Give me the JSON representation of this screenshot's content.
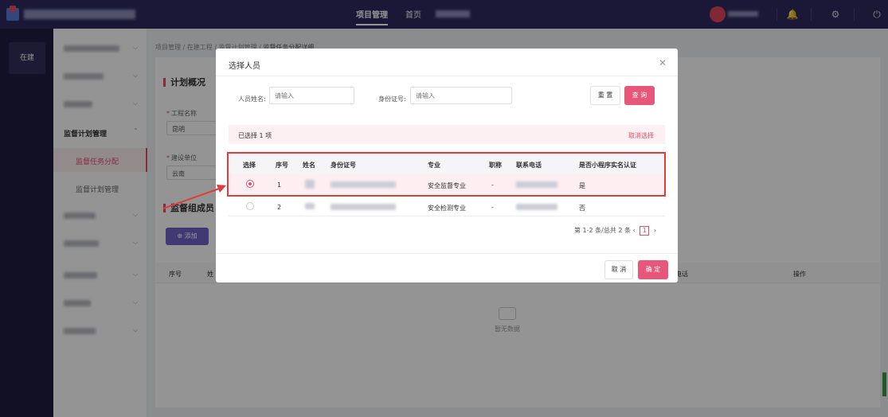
{
  "topbar": {
    "nav_active": "项目管理",
    "nav_home": "首页",
    "icons": [
      "bell-icon",
      "settings-icon",
      "power-icon"
    ]
  },
  "rail": {
    "label": "在建"
  },
  "sidebar": {
    "group_label": "监督计划管理",
    "sub_items": [
      {
        "label": "监督任务分配",
        "active": true
      },
      {
        "label": "监督计划管理",
        "active": false
      }
    ]
  },
  "page": {
    "breadcrumb": [
      "项目管理",
      "在建工程",
      "监督计划管理",
      "监督任务分配详细"
    ],
    "section_plan": "计划概况",
    "field_project": "工程名称",
    "field_project_value": "昆明",
    "field_builder": "建设单位",
    "field_builder_value": "云南",
    "section_members": "监督组成员",
    "add_button": "添加",
    "table_headers": [
      "序号",
      "姓",
      "电话",
      "操作"
    ],
    "empty_text": "暂无数据"
  },
  "modal": {
    "title": "选择人员",
    "name_label": "人员姓名:",
    "name_placeholder": "请输入",
    "id_label": "身份证号:",
    "id_placeholder": "请输入",
    "reset_button": "重 置",
    "query_button": "查 询",
    "selected_text": "已选择 1 项",
    "cancel_selection": "取消选择",
    "columns": [
      "选择",
      "序号",
      "姓名",
      "身份证号",
      "专业",
      "职称",
      "联系电话",
      "是否小程序实名认证"
    ],
    "rows": [
      {
        "selected": true,
        "index": "1",
        "major": "安全监督专业",
        "title": "-",
        "verified": "是"
      },
      {
        "selected": false,
        "index": "2",
        "major": "安全检测专业",
        "title": "-",
        "verified": "否"
      }
    ],
    "pagination_text": "第 1-2 条/总共 2 条",
    "current_page": "1",
    "cancel_button": "取 消",
    "ok_button": "确 定"
  },
  "colors": {
    "accent": "#e8577a",
    "topbar": "#2e2a5e",
    "highlight": "#e03c3c"
  }
}
